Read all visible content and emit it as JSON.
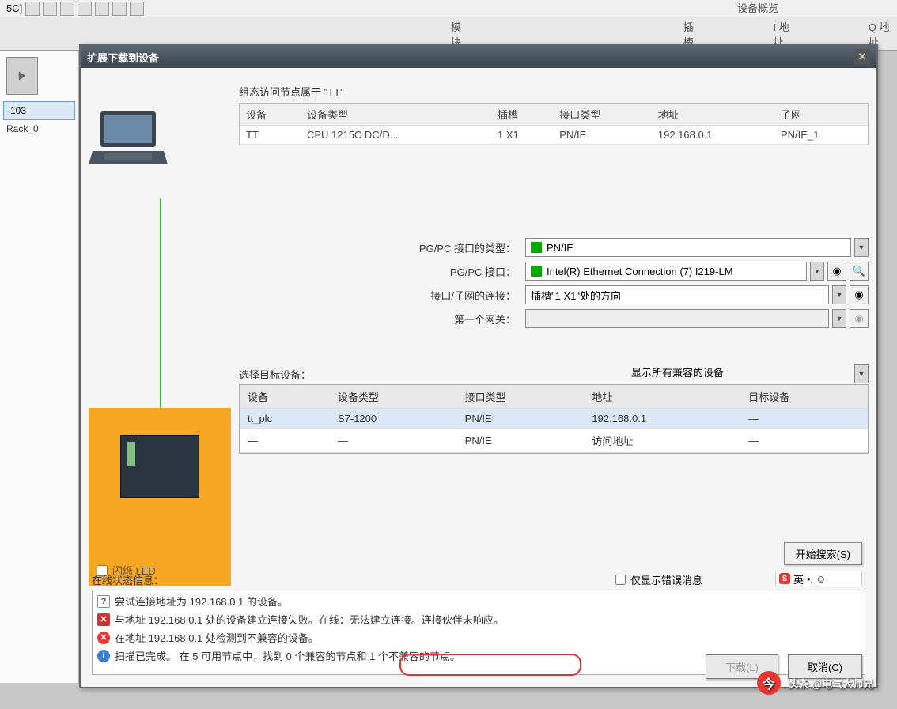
{
  "toolbar": {
    "bg_label_partial": "5C]",
    "top_tab": "设备概览"
  },
  "tabs": {
    "module": "模块",
    "slot": "插槽",
    "iaddr": "I 地址",
    "qaddr": "Q 地址"
  },
  "sidebar": {
    "item_103": "103",
    "rack": "Rack_0"
  },
  "dialog": {
    "title": "扩展下载到设备",
    "cfg_head": "组态访问节点属于 \"TT\"",
    "cfg_cols": {
      "device": "设备",
      "dtype": "设备类型",
      "slot": "插槽",
      "itype": "接口类型",
      "addr": "地址",
      "subnet": "子网"
    },
    "cfg_row": {
      "device": "TT",
      "dtype": "CPU 1215C DC/D...",
      "slot": "1 X1",
      "itype": "PN/IE",
      "addr": "192.168.0.1",
      "subnet": "PN/IE_1"
    },
    "form": {
      "pgpc_type_l": "PG/PC 接口的类型：",
      "pgpc_type_v": "PN/IE",
      "pgpc_if_l": "PG/PC 接口：",
      "pgpc_if_v": "Intel(R) Ethernet Connection (7) I219-LM",
      "conn_l": "接口/子网的连接：",
      "conn_v": "插槽\"1 X1\"处的方向",
      "gw_l": "第一个网关：",
      "gw_v": ""
    },
    "target": {
      "label": "选择目标设备：",
      "combo": "显示所有兼容的设备"
    },
    "dev_cols": {
      "device": "设备",
      "dtype": "设备类型",
      "itype": "接口类型",
      "addr": "地址",
      "tgt": "目标设备"
    },
    "dev_rows": [
      {
        "device": "tt_plc",
        "dtype": "S7-1200",
        "itype": "PN/IE",
        "addr": "192.168.0.1",
        "tgt": "—"
      },
      {
        "device": "—",
        "dtype": "—",
        "itype": "PN/IE",
        "addr": "访问地址",
        "tgt": "—"
      }
    ],
    "led_label": "闪烁 LED",
    "search_btn": "开始搜索(S)",
    "status_head": "在线状态信息：",
    "err_only": "仅显示错误消息",
    "status": [
      "尝试连接地址为 192.168.0.1 的设备。",
      "与地址 192.168.0.1 处的设备建立连接失败。在线：无法建立连接。连接伙伴未响应。",
      "在地址 192.168.0.1 处检测到不兼容的设备。",
      "扫描已完成。 在 5 可用节点中，找到 0 个兼容的节点和 1 个不兼容的节点。"
    ],
    "btn_load": "下载(L)",
    "btn_cancel": "取消(C)"
  },
  "ime": {
    "lang": "英"
  },
  "watermark": "头条 @电气大师兄"
}
